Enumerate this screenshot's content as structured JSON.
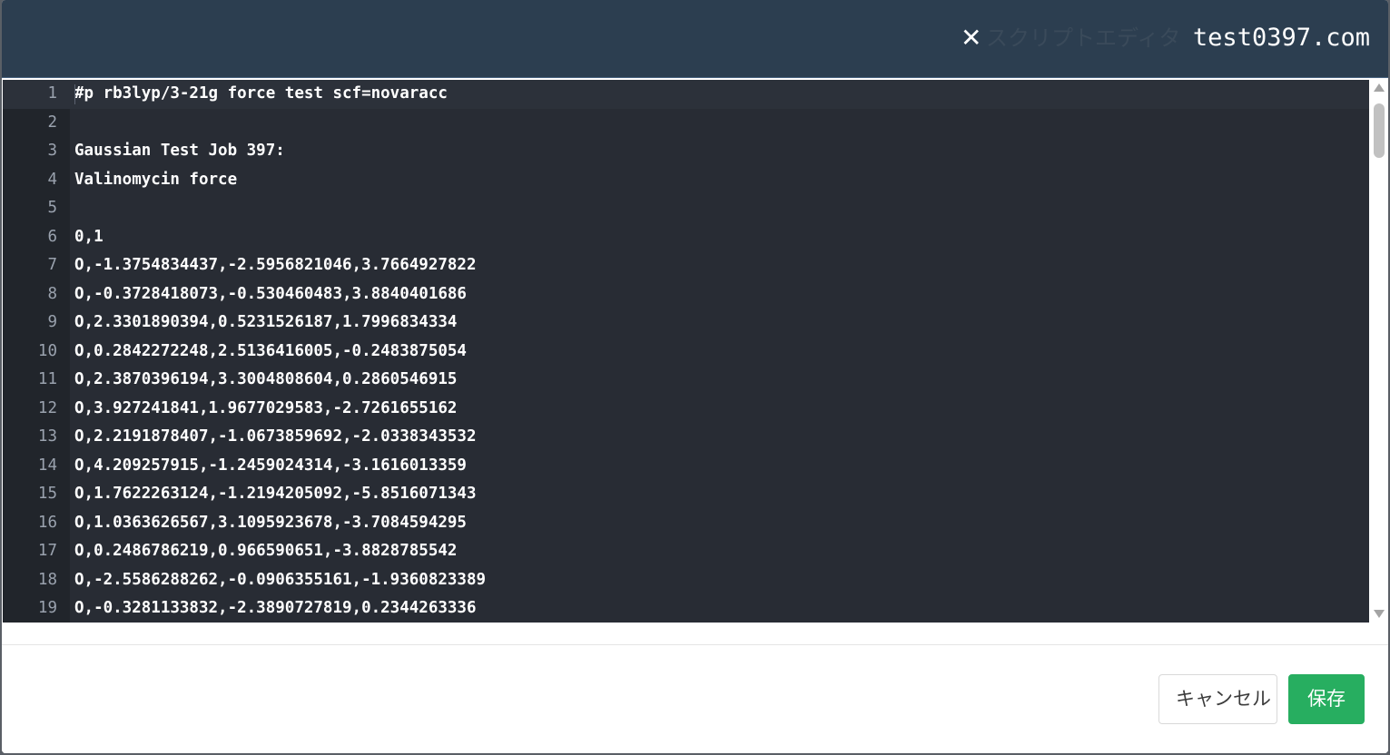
{
  "header": {
    "close_icon": "close-icon",
    "title": "スクリプトエディタ",
    "host": "test0397.com"
  },
  "editor": {
    "lines": [
      {
        "n": "1",
        "text": "#p rb3lyp/3-21g force test scf=novaracc"
      },
      {
        "n": "2",
        "text": ""
      },
      {
        "n": "3",
        "text": "Gaussian Test Job 397:"
      },
      {
        "n": "4",
        "text": "Valinomycin force"
      },
      {
        "n": "5",
        "text": ""
      },
      {
        "n": "6",
        "text": "0,1"
      },
      {
        "n": "7",
        "text": "O,-1.3754834437,-2.5956821046,3.7664927822"
      },
      {
        "n": "8",
        "text": "O,-0.3728418073,-0.530460483,3.8840401686"
      },
      {
        "n": "9",
        "text": "O,2.3301890394,0.5231526187,1.7996834334"
      },
      {
        "n": "10",
        "text": "O,0.2842272248,2.5136416005,-0.2483875054"
      },
      {
        "n": "11",
        "text": "O,2.3870396194,3.3004808604,0.2860546915"
      },
      {
        "n": "12",
        "text": "O,3.927241841,1.9677029583,-2.7261655162"
      },
      {
        "n": "13",
        "text": "O,2.2191878407,-1.0673859692,-2.0338343532"
      },
      {
        "n": "14",
        "text": "O,4.209257915,-1.2459024314,-3.1616013359"
      },
      {
        "n": "15",
        "text": "O,1.7622263124,-1.2194205092,-5.8516071343"
      },
      {
        "n": "16",
        "text": "O,1.0363626567,3.1095923678,-3.7084594295"
      },
      {
        "n": "17",
        "text": "O,0.2486786219,0.966590651,-3.8828785542"
      },
      {
        "n": "18",
        "text": "O,-2.5586288262,-0.0906355161,-1.9360823389"
      },
      {
        "n": "19",
        "text": "O,-0.3281133832,-2.3890727819,0.2344263336"
      }
    ]
  },
  "footer": {
    "cancel_label": "キャンセル",
    "save_label": "保存"
  },
  "colors": {
    "header_bg": "#2c3e50",
    "editor_bg": "#282c34",
    "gutter_bg": "#21252b",
    "save_green": "#27ae60"
  }
}
